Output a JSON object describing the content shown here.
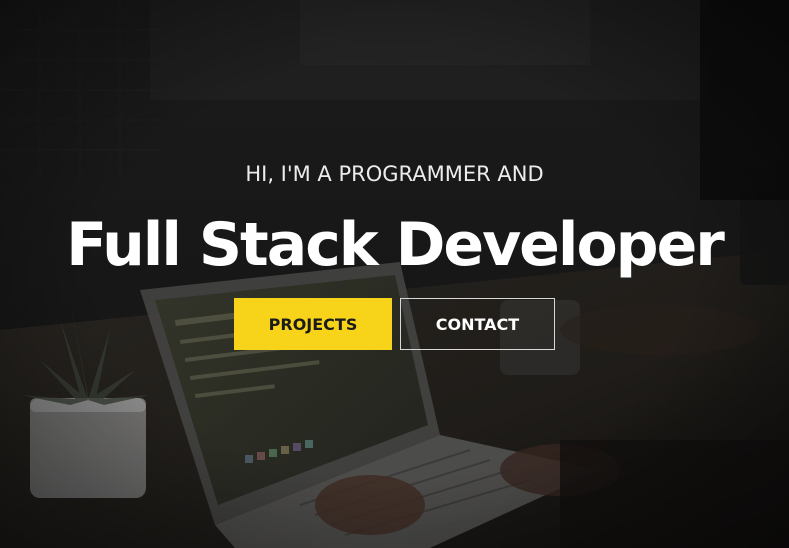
{
  "hero": {
    "subtitle": "HI, I'M A PROGRAMMER AND",
    "title": "Full Stack Developer",
    "buttons": {
      "projects_label": "PROJECTS",
      "contact_label": "CONTACT"
    },
    "colors": {
      "accent": "#f7d41a",
      "text": "#ffffff",
      "overlay": "#0a0a0a"
    },
    "background_image": "laptop-workspace-photo"
  }
}
